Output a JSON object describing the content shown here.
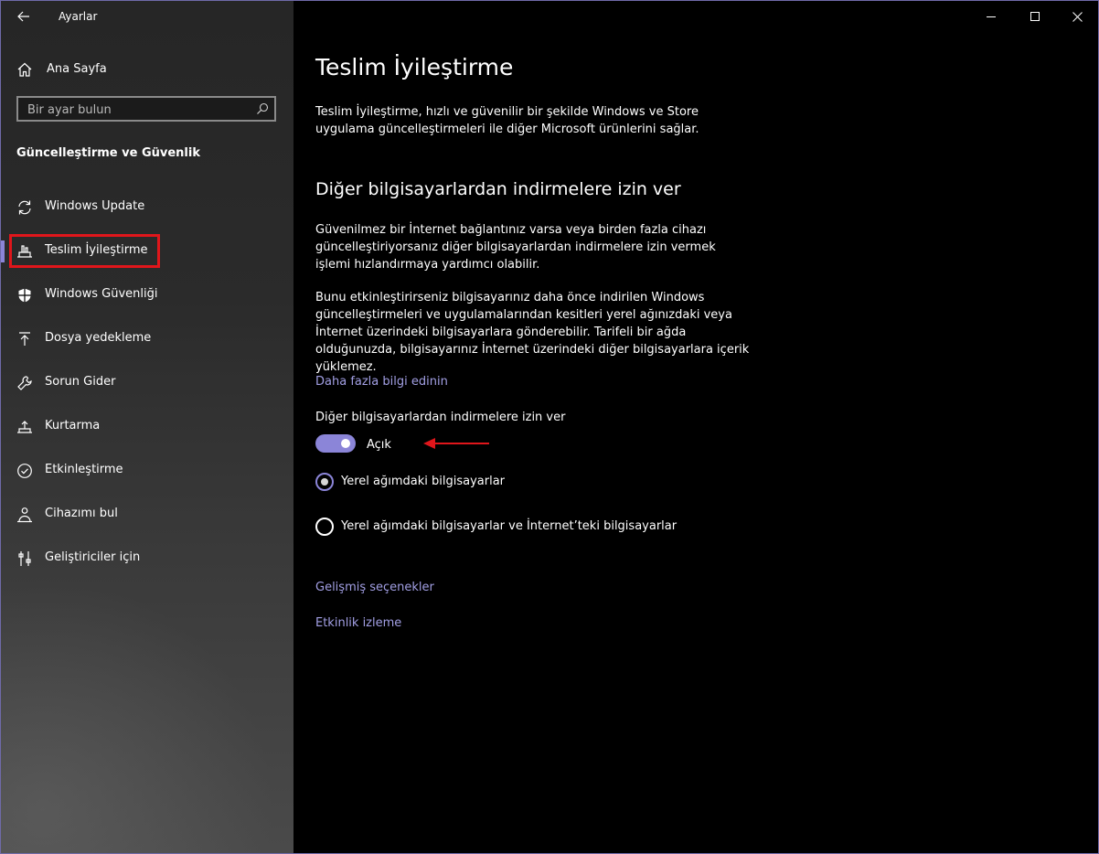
{
  "window": {
    "title": "Ayarlar",
    "controls": [
      "minimize-icon",
      "maximize-icon",
      "close-icon"
    ]
  },
  "sidebar": {
    "home_label": "Ana Sayfa",
    "search_placeholder": "Bir ayar bulun",
    "section_title": "Güncelleştirme ve Güvenlik",
    "items": [
      {
        "label": "Windows Update",
        "icon": "sync-icon",
        "active": false
      },
      {
        "label": "Teslim İyileştirme",
        "icon": "delivery-optimization-icon",
        "active": true
      },
      {
        "label": "Windows Güvenliği",
        "icon": "shield-icon",
        "active": false
      },
      {
        "label": "Dosya yedekleme",
        "icon": "backup-arrow-icon",
        "active": false
      },
      {
        "label": "Sorun Gider",
        "icon": "wrench-icon",
        "active": false
      },
      {
        "label": "Kurtarma",
        "icon": "recovery-icon",
        "active": false
      },
      {
        "label": "Etkinleştirme",
        "icon": "check-circle-icon",
        "active": false
      },
      {
        "label": "Cihazımı bul",
        "icon": "person-pin-icon",
        "active": false
      },
      {
        "label": "Geliştiriciler için",
        "icon": "developer-tools-icon",
        "active": false
      }
    ]
  },
  "main": {
    "title": "Teslim İyileştirme",
    "intro_lines": [
      "Teslim İyileştirme, hızlı ve güvenilir bir şekilde Windows ve Store",
      "uygulama güncelleştirmeleri ile diğer Microsoft ürünlerini sağlar."
    ],
    "subheading": "Diğer bilgisayarlardan indirmelere izin ver",
    "para1_lines": [
      "Güvenilmez bir İnternet bağlantınız varsa veya birden fazla cihazı",
      "güncelleştiriyorsanız diğer bilgisayarlardan indirmelere izin vermek",
      "işlemi hızlandırmaya yardımcı olabilir."
    ],
    "para2_lines": [
      "Bunu etkinleştirirseniz bilgisayarınız daha önce indirilen Windows",
      "güncelleştirmeleri ve uygulamalarından kesitleri yerel ağınızdaki veya",
      "İnternet üzerindeki bilgisayarlara gönderebilir. Tarifeli bir ağda",
      "olduğunuzda, bilgisayarınız İnternet üzerindeki diğer bilgisayarlara içerik",
      "yüklemez."
    ],
    "learn_more_link": "Daha fazla bilgi edinin",
    "toggle": {
      "label": "Diğer bilgisayarlardan indirmelere izin ver",
      "state_text": "Açık",
      "on": true
    },
    "radio_options": [
      {
        "label": "Yerel ağımdaki bilgisayarlar",
        "checked": true
      },
      {
        "label": "Yerel ağımdaki bilgisayarlar ve İnternet’teki bilgisayarlar",
        "checked": false
      }
    ],
    "advanced_link": "Gelişmiş seçenekler",
    "activity_link": "Etkinlik izleme"
  },
  "colors": {
    "accent": "#8b85d8",
    "link": "#a29fe4",
    "highlight_box": "#e0161b",
    "annotation_arrow": "#e0161b"
  }
}
